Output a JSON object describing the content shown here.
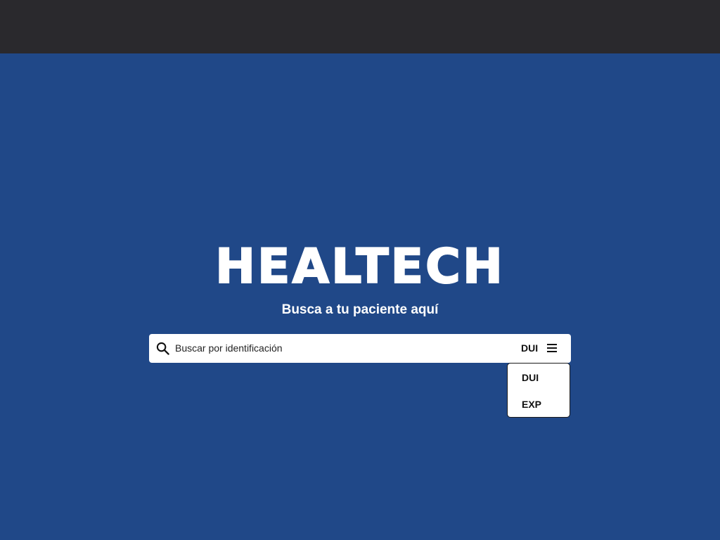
{
  "header": {
    "background_color": "#2a292d"
  },
  "main": {
    "background_color": "#204888",
    "logo_text": "HEALTECH",
    "subtitle": "Busca a tu paciente aquí"
  },
  "search": {
    "icon": "search-icon",
    "placeholder": "Buscar por identificación",
    "value": "",
    "selected_type": "DUI",
    "menu_icon": "hamburger-menu-icon"
  },
  "dropdown": {
    "options": [
      {
        "label": "DUI"
      },
      {
        "label": "EXP"
      }
    ]
  }
}
